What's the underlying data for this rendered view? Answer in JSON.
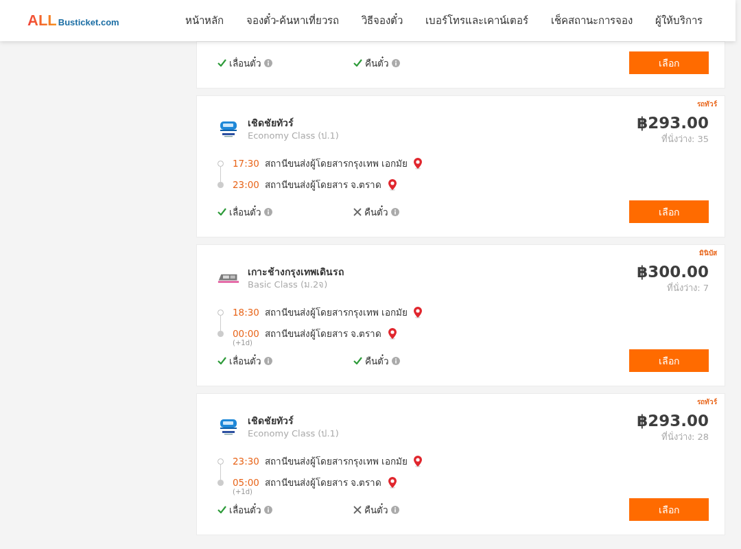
{
  "header": {
    "logo": {
      "accent": "ALL",
      "name": "Busticket.com"
    },
    "nav": [
      "หน้าหลัก",
      "จองตั๋ว-ค้นหาเที่ยวรถ",
      "วิธีจองตั๋ว",
      "เบอร์โทรและเคาน์เตอร์",
      "เช็คสถานะการจอง",
      "ผู้ให้บริการ"
    ]
  },
  "trips": [
    {
      "features": [
        {
          "label": "เลื่อนตั๋ว",
          "available": true
        },
        {
          "label": "คืนตั๋ว",
          "available": true
        }
      ],
      "button": "เลือก"
    },
    {
      "tag": "รถทัวร์",
      "logo": {
        "kind": "coach"
      },
      "operator": "เชิดชัยทัวร์",
      "class": "Economy Class (ป.1)",
      "price": "฿293.00",
      "seats": "ที่นั่งว่าง: 35",
      "stops": [
        {
          "kind": "departure",
          "time": "17:30",
          "station": "สถานีขนส่งผู้โดยสารกรุงเทพ เอกมัย"
        },
        {
          "kind": "arrival",
          "time": "23:00",
          "station": "สถานีขนส่งผู้โดยสาร จ.ตราด"
        }
      ],
      "features": [
        {
          "label": "เลื่อนตั๋ว",
          "available": true
        },
        {
          "label": "คืนตั๋ว",
          "available": false
        }
      ],
      "button": "เลือก"
    },
    {
      "tag": "มินิบัส",
      "logo": {
        "kind": "van"
      },
      "operator": "เกาะช้างกรุงเทพเดินรถ",
      "class": "Basic Class (ม.2จ)",
      "price": "฿300.00",
      "seats": "ที่นั่งว่าง: 7",
      "stops": [
        {
          "kind": "departure",
          "time": "18:30",
          "station": "สถานีขนส่งผู้โดยสารกรุงเทพ เอกมัย"
        },
        {
          "kind": "arrival",
          "time": "00:00",
          "station": "สถานีขนส่งผู้โดยสาร จ.ตราด",
          "day_offset": "(+1d)"
        }
      ],
      "features": [
        {
          "label": "เลื่อนตั๋ว",
          "available": true
        },
        {
          "label": "คืนตั๋ว",
          "available": true
        }
      ],
      "button": "เลือก"
    },
    {
      "tag": "รถทัวร์",
      "logo": {
        "kind": "coach"
      },
      "operator": "เชิดชัยทัวร์",
      "class": "Economy Class (ป.1)",
      "price": "฿293.00",
      "seats": "ที่นั่งว่าง: 28",
      "stops": [
        {
          "kind": "departure",
          "time": "23:30",
          "station": "สถานีขนส่งผู้โดยสารกรุงเทพ เอกมัย"
        },
        {
          "kind": "arrival",
          "time": "05:00",
          "station": "สถานีขนส่งผู้โดยสาร จ.ตราด",
          "day_offset": "(+1d)"
        }
      ],
      "features": [
        {
          "label": "เลื่อนตั๋ว",
          "available": true
        },
        {
          "label": "คืนตั๋ว",
          "available": false
        }
      ],
      "button": "เลือก"
    }
  ]
}
